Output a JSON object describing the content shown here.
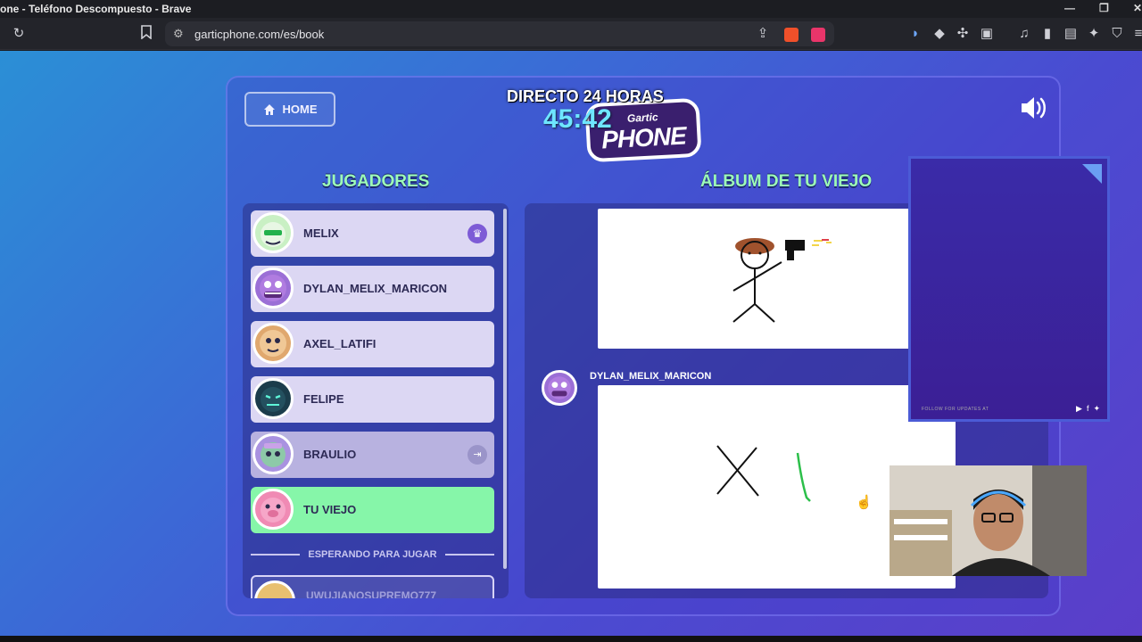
{
  "window": {
    "title": "one - Teléfono Descompuesto - Brave"
  },
  "browser": {
    "url": "garticphone.com/es/book"
  },
  "game": {
    "home_label": "HOME",
    "logo_top": "Gartic",
    "logo_main": "PHONE",
    "players_title": "JUGADORES",
    "album_title": "ÁLBUM DE TU VIEJO",
    "players": [
      {
        "name": "MELIX",
        "host": true,
        "color": "#c9f0c4"
      },
      {
        "name": "DYLAN_MELIX_MARICON",
        "color": "#9b6fd6"
      },
      {
        "name": "AXEL_LATIFI",
        "color": "#e0a86e"
      },
      {
        "name": "FELIPE",
        "color": "#1b3c4b"
      },
      {
        "name": "BRAULIO",
        "color": "#a992e0"
      },
      {
        "name": "TU VIEJO",
        "color": "#f08ab4"
      }
    ],
    "waiting_label": "ESPERANDO PARA JUGAR",
    "waiting_player": "UWUJIANOSUPREMO777",
    "album_author": "DYLAN_MELIX_MARICON"
  },
  "stream_overlay": {
    "title": "DIRECTO 24 HORAS",
    "timer": "45:42",
    "follow_text": "FOLLOW FOR UPDATES AT"
  }
}
